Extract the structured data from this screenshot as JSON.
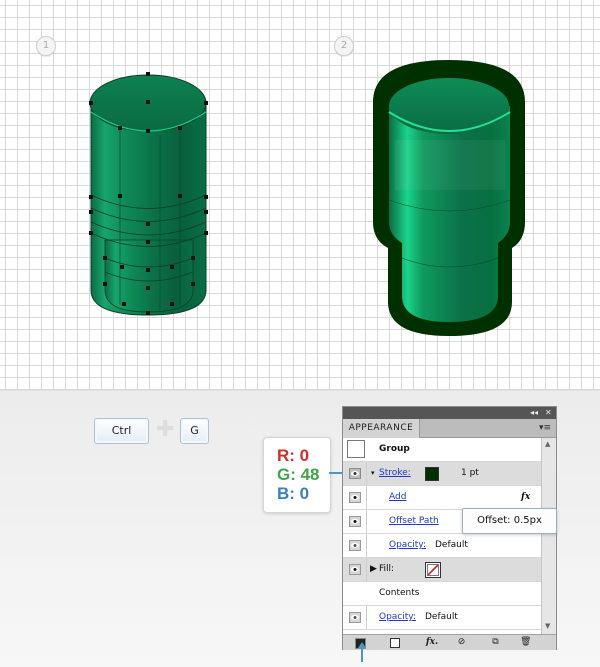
{
  "steps": [
    "1",
    "2"
  ],
  "keys": {
    "ctrl": "Ctrl",
    "g": "G"
  },
  "color_readout": {
    "r": "R: 0",
    "g": "G: 48",
    "b": "B: 0"
  },
  "panel": {
    "title": "APPEARANCE",
    "group_label": "Group",
    "stroke": {
      "label": "Stroke:",
      "weight": "1 pt",
      "color": "#003000"
    },
    "add_label": "Add",
    "fx_label": "fx",
    "offset_path_label": "Offset Path",
    "inner_opacity": {
      "label": "Opacity:",
      "value": "Default"
    },
    "fill_label": "Fill:",
    "contents_label": "Contents",
    "outer_opacity": {
      "label": "Opacity:",
      "value": "Default"
    }
  },
  "tooltip": "Offset: 0.5px",
  "colors": {
    "red": "#d62b2b",
    "green": "#3da64a",
    "blue": "#3b7fc1",
    "object_green": "#0a7d4f",
    "stroke_green": "#003000"
  },
  "icons": [
    "eye-icon",
    "fx-icon",
    "new-art-icon",
    "clear-icon",
    "duplicate-icon",
    "trash-icon",
    "panel-menu-icon",
    "collapse-icon",
    "close-icon"
  ]
}
